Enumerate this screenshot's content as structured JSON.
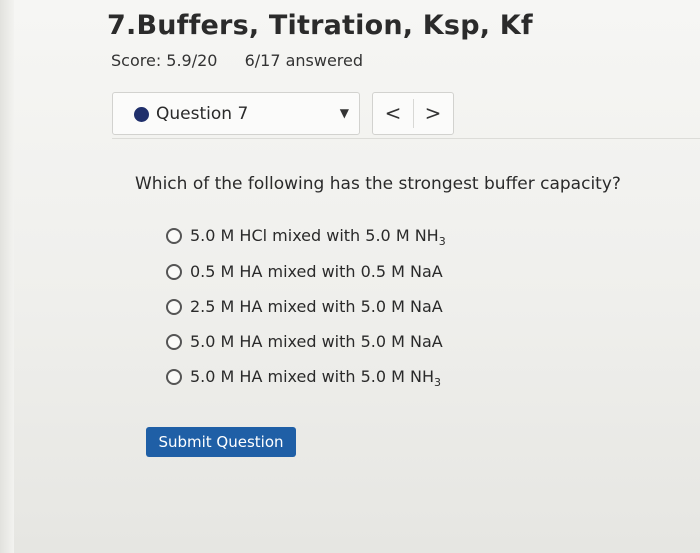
{
  "header": {
    "title": "7.Buffers, Titration, Ksp, Kf",
    "score": "Score: 5.9/20",
    "answered": "6/17 answered"
  },
  "question_selector": {
    "label": "Question 7",
    "dropdown_icon": "triangle-down",
    "prev_label": "<",
    "next_label": ">"
  },
  "question": {
    "prompt": "Which of the following has the strongest buffer capacity?",
    "options": [
      {
        "text": "5.0 M HCl mixed with 5.0 M NH",
        "sub": "3"
      },
      {
        "text": "0.5 M HA mixed with 0.5 M NaA",
        "sub": ""
      },
      {
        "text": "2.5 M HA mixed with 5.0 M NaA",
        "sub": ""
      },
      {
        "text": "5.0 M HA mixed with 5.0 M NaA",
        "sub": ""
      },
      {
        "text": "5.0 M HA mixed with 5.0 M NH",
        "sub": "3"
      }
    ]
  },
  "submit_label": "Submit Question",
  "colors": {
    "accent": "#1f5fa6",
    "question_dot": "#1f2f6b"
  }
}
